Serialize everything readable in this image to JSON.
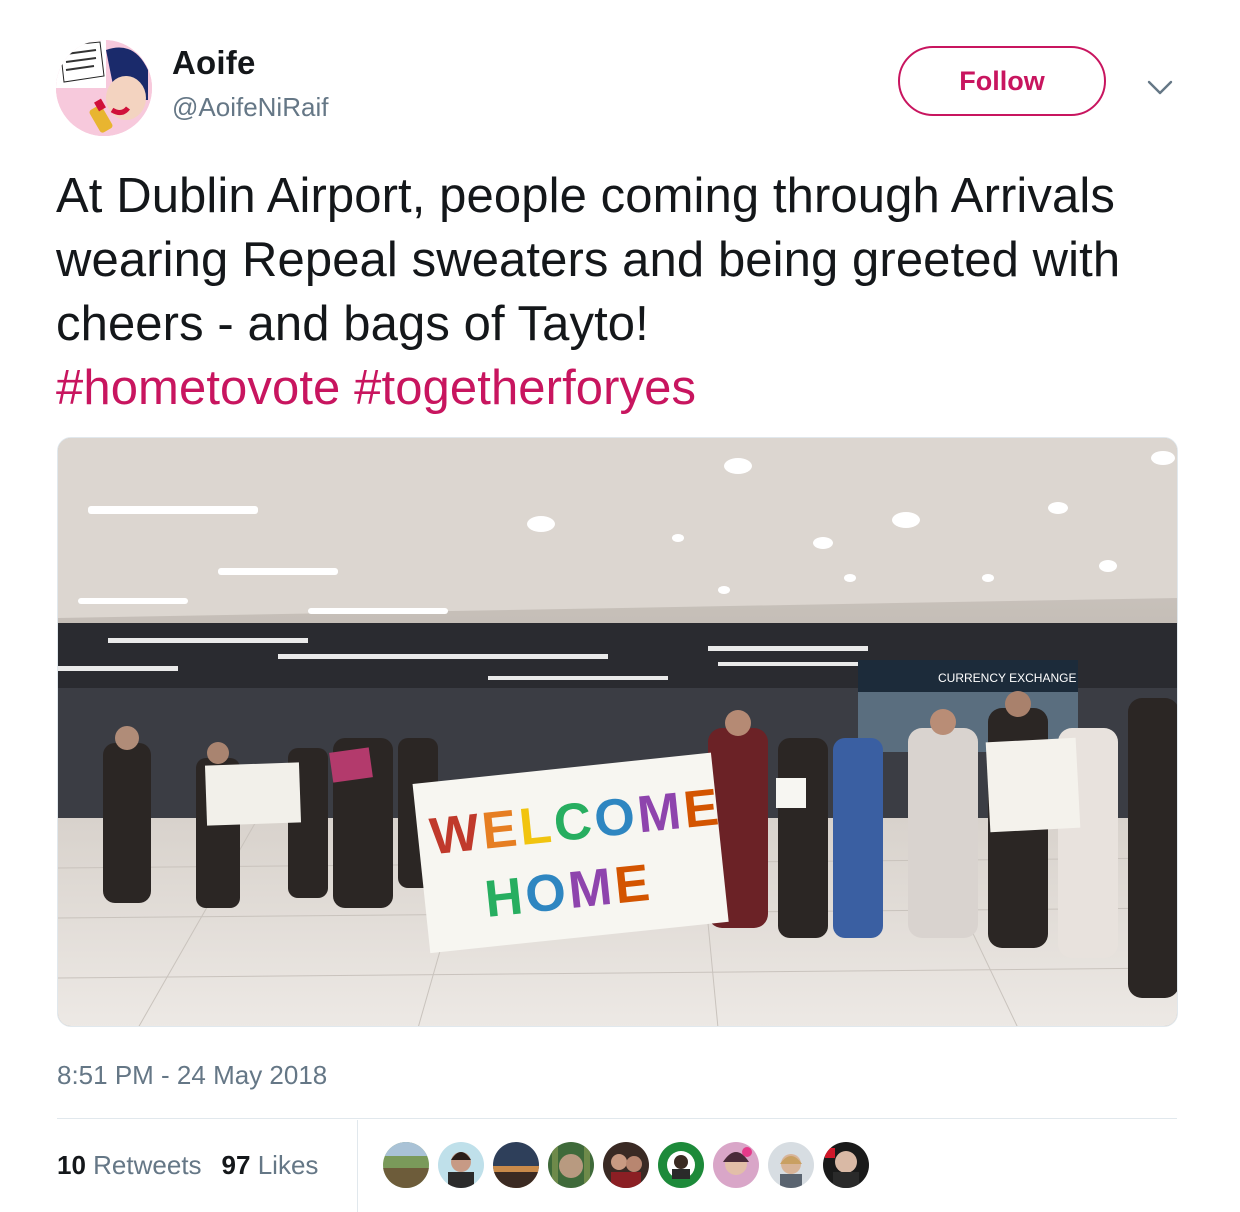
{
  "author": {
    "display_name": "Aoife",
    "handle": "@AoifeNiRaif",
    "avatar_icon": "pop-art-lipstick-avatar"
  },
  "header": {
    "follow_label": "Follow",
    "menu_icon": "chevron-down-icon"
  },
  "tweet": {
    "text": "At Dublin Airport, people coming through Arrivals wearing Repeal sweaters and being greeted with cheers - and bags of Tayto!",
    "hashtags": [
      "#hometovote",
      "#togetherforyes"
    ]
  },
  "media": {
    "banner_line1": "WELCOME",
    "banner_line2": "HOME",
    "sign_currency": "CURRENCY EXCHANGE"
  },
  "timestamp": "8:51 PM - 24 May 2018",
  "stats": {
    "retweets_count": "10",
    "retweets_label": "Retweets",
    "likes_count": "97",
    "likes_label": "Likes"
  },
  "colors": {
    "accent": "#c8155f",
    "secondary_text": "#657786",
    "divider": "#e1e8ed"
  }
}
